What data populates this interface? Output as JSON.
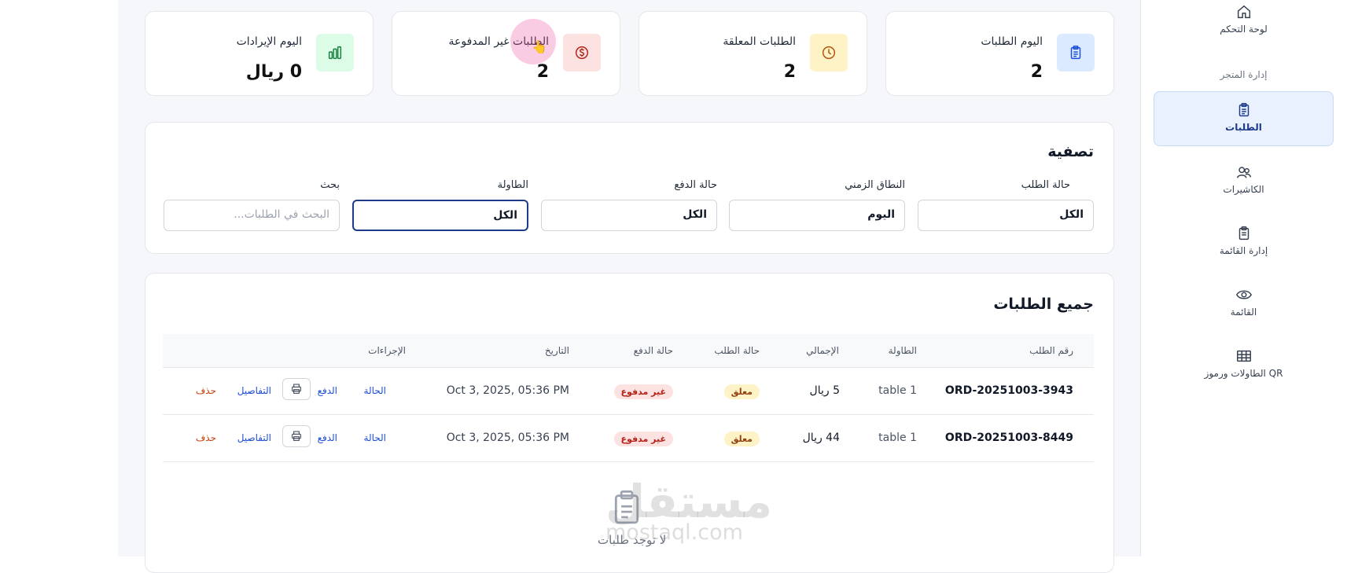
{
  "sidebar": {
    "items": [
      {
        "label": "لوحة التحكم",
        "icon": "home-icon"
      },
      {
        "section": "إدارة المتجر"
      },
      {
        "label": "الطلبات",
        "icon": "clipboard-icon",
        "active": true
      },
      {
        "label": "الكاشيرات",
        "icon": "users-icon"
      },
      {
        "label": "إدارة القائمة",
        "icon": "clipboard-list-icon"
      },
      {
        "label": "القائمة",
        "icon": "eye-icon"
      },
      {
        "label": "الطاولات ورموز QR",
        "icon": "table-icon"
      }
    ]
  },
  "stats": [
    {
      "label": "اليوم الطلبات",
      "value": "2",
      "icon": "clipboard-icon",
      "color": "#dbeafe"
    },
    {
      "label": "الطلبات المعلقة",
      "value": "2",
      "icon": "clock-icon",
      "color": "#fef3c7"
    },
    {
      "label": "الطلبات غير المدفوعة",
      "value": "2",
      "icon": "dollar-icon",
      "color": "#fde2e2"
    },
    {
      "label": "اليوم الإيرادات",
      "value": "0 ريال",
      "icon": "bar-chart-icon",
      "color": "#dcfce7"
    }
  ],
  "filters": {
    "title": "تصفية",
    "order_status": {
      "label": "حالة الطلب",
      "value": "الكل"
    },
    "time_range": {
      "label": "النطاق الزمني",
      "value": "اليوم"
    },
    "payment_status": {
      "label": "حالة الدفع",
      "value": "الكل"
    },
    "table": {
      "label": "الطاولة",
      "value": "الكل"
    },
    "search": {
      "label": "بحث",
      "placeholder": "البحث في الطلبات..."
    }
  },
  "orders": {
    "title": "جميع الطلبات",
    "columns": {
      "order_no": "رقم الطلب",
      "table": "الطاولة",
      "total": "الإجمالي",
      "order_status": "حالة الطلب",
      "payment_status": "حالة الدفع",
      "date": "التاريخ",
      "actions": "الإجراءات"
    },
    "rows": [
      {
        "order_no": "ORD-20251003-3943",
        "table": "table 1",
        "total": "5 ريال",
        "order_status": "معلق",
        "payment_status": "غير مدفوع",
        "date": "Oct 3, 2025, 05:36 PM"
      },
      {
        "order_no": "ORD-20251003-8449",
        "table": "table 1",
        "total": "44 ريال",
        "order_status": "معلق",
        "payment_status": "غير مدفوع",
        "date": "Oct 3, 2025, 05:36 PM"
      }
    ],
    "actions": {
      "status": "الحالة",
      "payment": "الدفع",
      "details": "التفاصيل",
      "delete": "حذف"
    },
    "empty_text": "لا توجد طلبات"
  },
  "watermark": {
    "text_ar": "مستقل",
    "text_en": "mostaql.com"
  }
}
